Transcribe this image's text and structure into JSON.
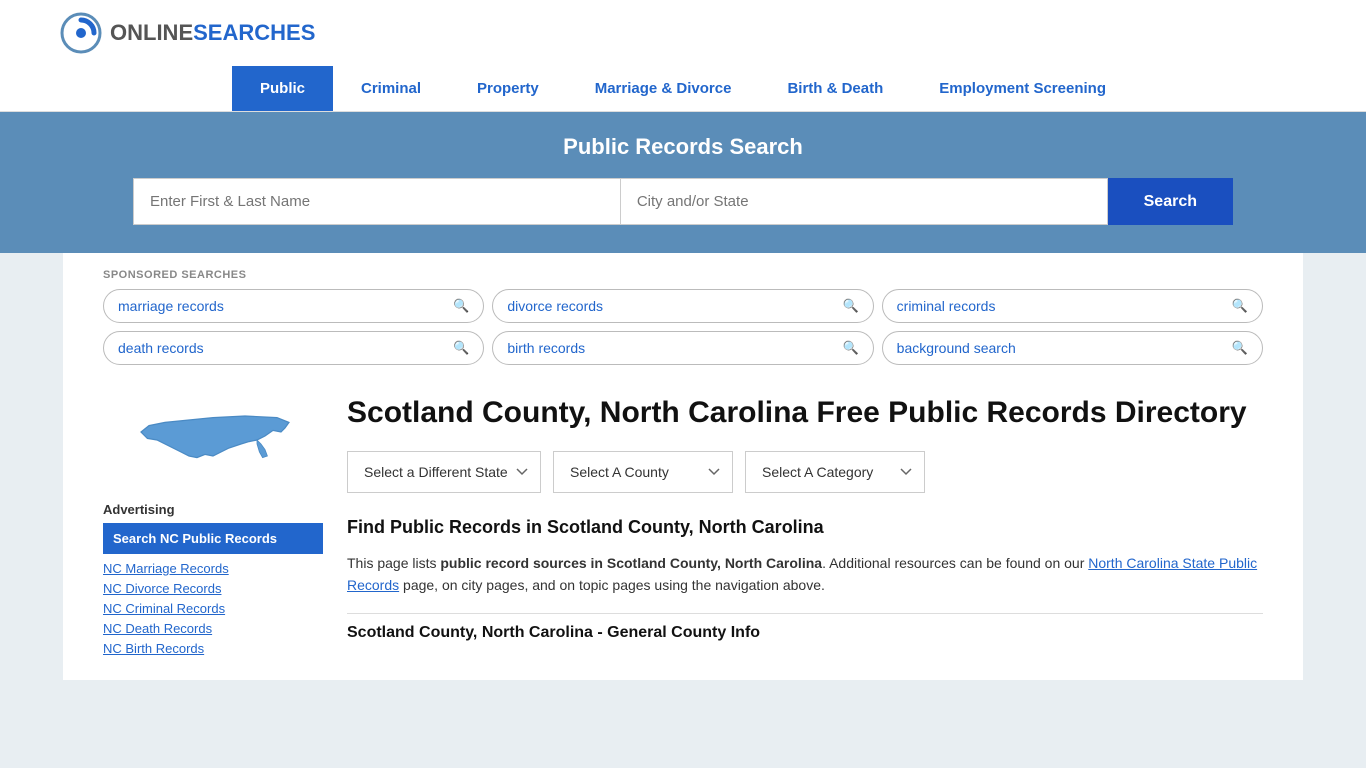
{
  "site": {
    "logo_online": "ONLINE",
    "logo_searches": "SEARCHES"
  },
  "nav": {
    "items": [
      {
        "label": "Public",
        "active": true
      },
      {
        "label": "Criminal",
        "active": false
      },
      {
        "label": "Property",
        "active": false
      },
      {
        "label": "Marriage & Divorce",
        "active": false
      },
      {
        "label": "Birth & Death",
        "active": false
      },
      {
        "label": "Employment Screening",
        "active": false
      }
    ]
  },
  "search_banner": {
    "title": "Public Records Search",
    "name_placeholder": "Enter First & Last Name",
    "location_placeholder": "City and/or State",
    "button_label": "Search"
  },
  "sponsored": {
    "label": "SPONSORED SEARCHES",
    "items": [
      "marriage records",
      "divorce records",
      "criminal records",
      "death records",
      "birth records",
      "background search"
    ]
  },
  "page": {
    "title": "Scotland County, North Carolina Free Public Records Directory",
    "find_title": "Find Public Records in Scotland County, North Carolina",
    "description_part1": "This page lists ",
    "description_bold": "public record sources in Scotland County, North Carolina",
    "description_part2": ". Additional resources can be found on our ",
    "description_link": "North Carolina State Public Records",
    "description_part3": " page, on city pages, and on topic pages using the navigation above.",
    "section_subtitle": "Scotland County, North Carolina - General County Info"
  },
  "dropdowns": {
    "state_label": "Select a Different State",
    "county_label": "Select A County",
    "category_label": "Select A Category"
  },
  "advertising": {
    "label": "Advertising",
    "ad_label": "Search NC Public Records",
    "links": [
      "NC Marriage Records",
      "NC Divorce Records",
      "NC Criminal Records",
      "NC Death Records",
      "NC Birth Records"
    ]
  },
  "colors": {
    "primary_blue": "#2266cc",
    "banner_blue": "#5b8db8",
    "dark_blue": "#1a4fbf"
  }
}
